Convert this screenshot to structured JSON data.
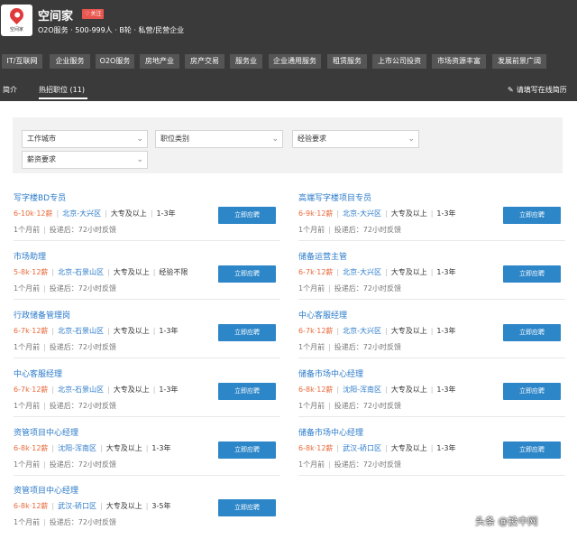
{
  "header": {
    "logo_text": "空间家",
    "company_name": "空间家",
    "follow_label": "关注",
    "company_info": "O2O服务 · 500-999人 · B轮 · 私营/民营企业"
  },
  "tags": [
    "IT/互联网",
    "企业服务",
    "O2O服务",
    "房地产业",
    "房产交易",
    "服务业",
    "企业通用服务",
    "租赁服务",
    "上市公司投资",
    "市场资源丰富",
    "发展前景广阔"
  ],
  "tabs": {
    "intro": "简介",
    "jobs": "热招职位 (11)",
    "online_resume": "请填写在线简历"
  },
  "filters": {
    "city": "工作城市",
    "category": "职位类别",
    "experience": "经验要求",
    "salary": "薪资要求"
  },
  "apply_label": "立即应聘",
  "jobs": [
    {
      "title": "写字楼BD专员",
      "salary": "6-10k·12薪",
      "location": "北京-大兴区",
      "education": "大专及以上",
      "experience": "1-3年",
      "posted": "1个月前",
      "feedback": "投递后：72小时反馈"
    },
    {
      "title": "高端写字楼项目专员",
      "salary": "6-9k·12薪",
      "location": "北京-大兴区",
      "education": "大专及以上",
      "experience": "1-3年",
      "posted": "1个月前",
      "feedback": "投递后：72小时反馈"
    },
    {
      "title": "市场助理",
      "salary": "5-8k·12薪",
      "location": "北京-石景山区",
      "education": "大专及以上",
      "experience": "经验不限",
      "posted": "1个月前",
      "feedback": "投递后：72小时反馈"
    },
    {
      "title": "储备运营主管",
      "salary": "6-7k·12薪",
      "location": "北京-大兴区",
      "education": "大专及以上",
      "experience": "1-3年",
      "posted": "1个月前",
      "feedback": "投递后：72小时反馈"
    },
    {
      "title": "行政储备管理岗",
      "salary": "6-7k·12薪",
      "location": "北京-石景山区",
      "education": "大专及以上",
      "experience": "1-3年",
      "posted": "1个月前",
      "feedback": "投递后：72小时反馈"
    },
    {
      "title": "中心客服经理",
      "salary": "6-7k·12薪",
      "location": "北京-大兴区",
      "education": "大专及以上",
      "experience": "1-3年",
      "posted": "1个月前",
      "feedback": "投递后：72小时反馈"
    },
    {
      "title": "中心客服经理",
      "salary": "6-7k·12薪",
      "location": "北京-石景山区",
      "education": "大专及以上",
      "experience": "1-3年",
      "posted": "1个月前",
      "feedback": "投递后：72小时反馈"
    },
    {
      "title": "储备市场中心经理",
      "salary": "6-8k·12薪",
      "location": "沈阳-浑南区",
      "education": "大专及以上",
      "experience": "1-3年",
      "posted": "1个月前",
      "feedback": "投递后：72小时反馈"
    },
    {
      "title": "资管项目中心经理",
      "salary": "6-8k·12薪",
      "location": "沈阳-浑南区",
      "education": "大专及以上",
      "experience": "1-3年",
      "posted": "1个月前",
      "feedback": "投递后：72小时反馈"
    },
    {
      "title": "储备市场中心经理",
      "salary": "6-8k·12薪",
      "location": "武汉-硚口区",
      "education": "大专及以上",
      "experience": "1-3年",
      "posted": "1个月前",
      "feedback": "投递后：72小时反馈"
    },
    {
      "title": "资管项目中心经理",
      "salary": "6-8k·12薪",
      "location": "武汉-硚口区",
      "education": "大专及以上",
      "experience": "3-5年",
      "posted": "1个月前",
      "feedback": "投递后：72小时反馈"
    }
  ],
  "watermark": "头条 @投中网"
}
